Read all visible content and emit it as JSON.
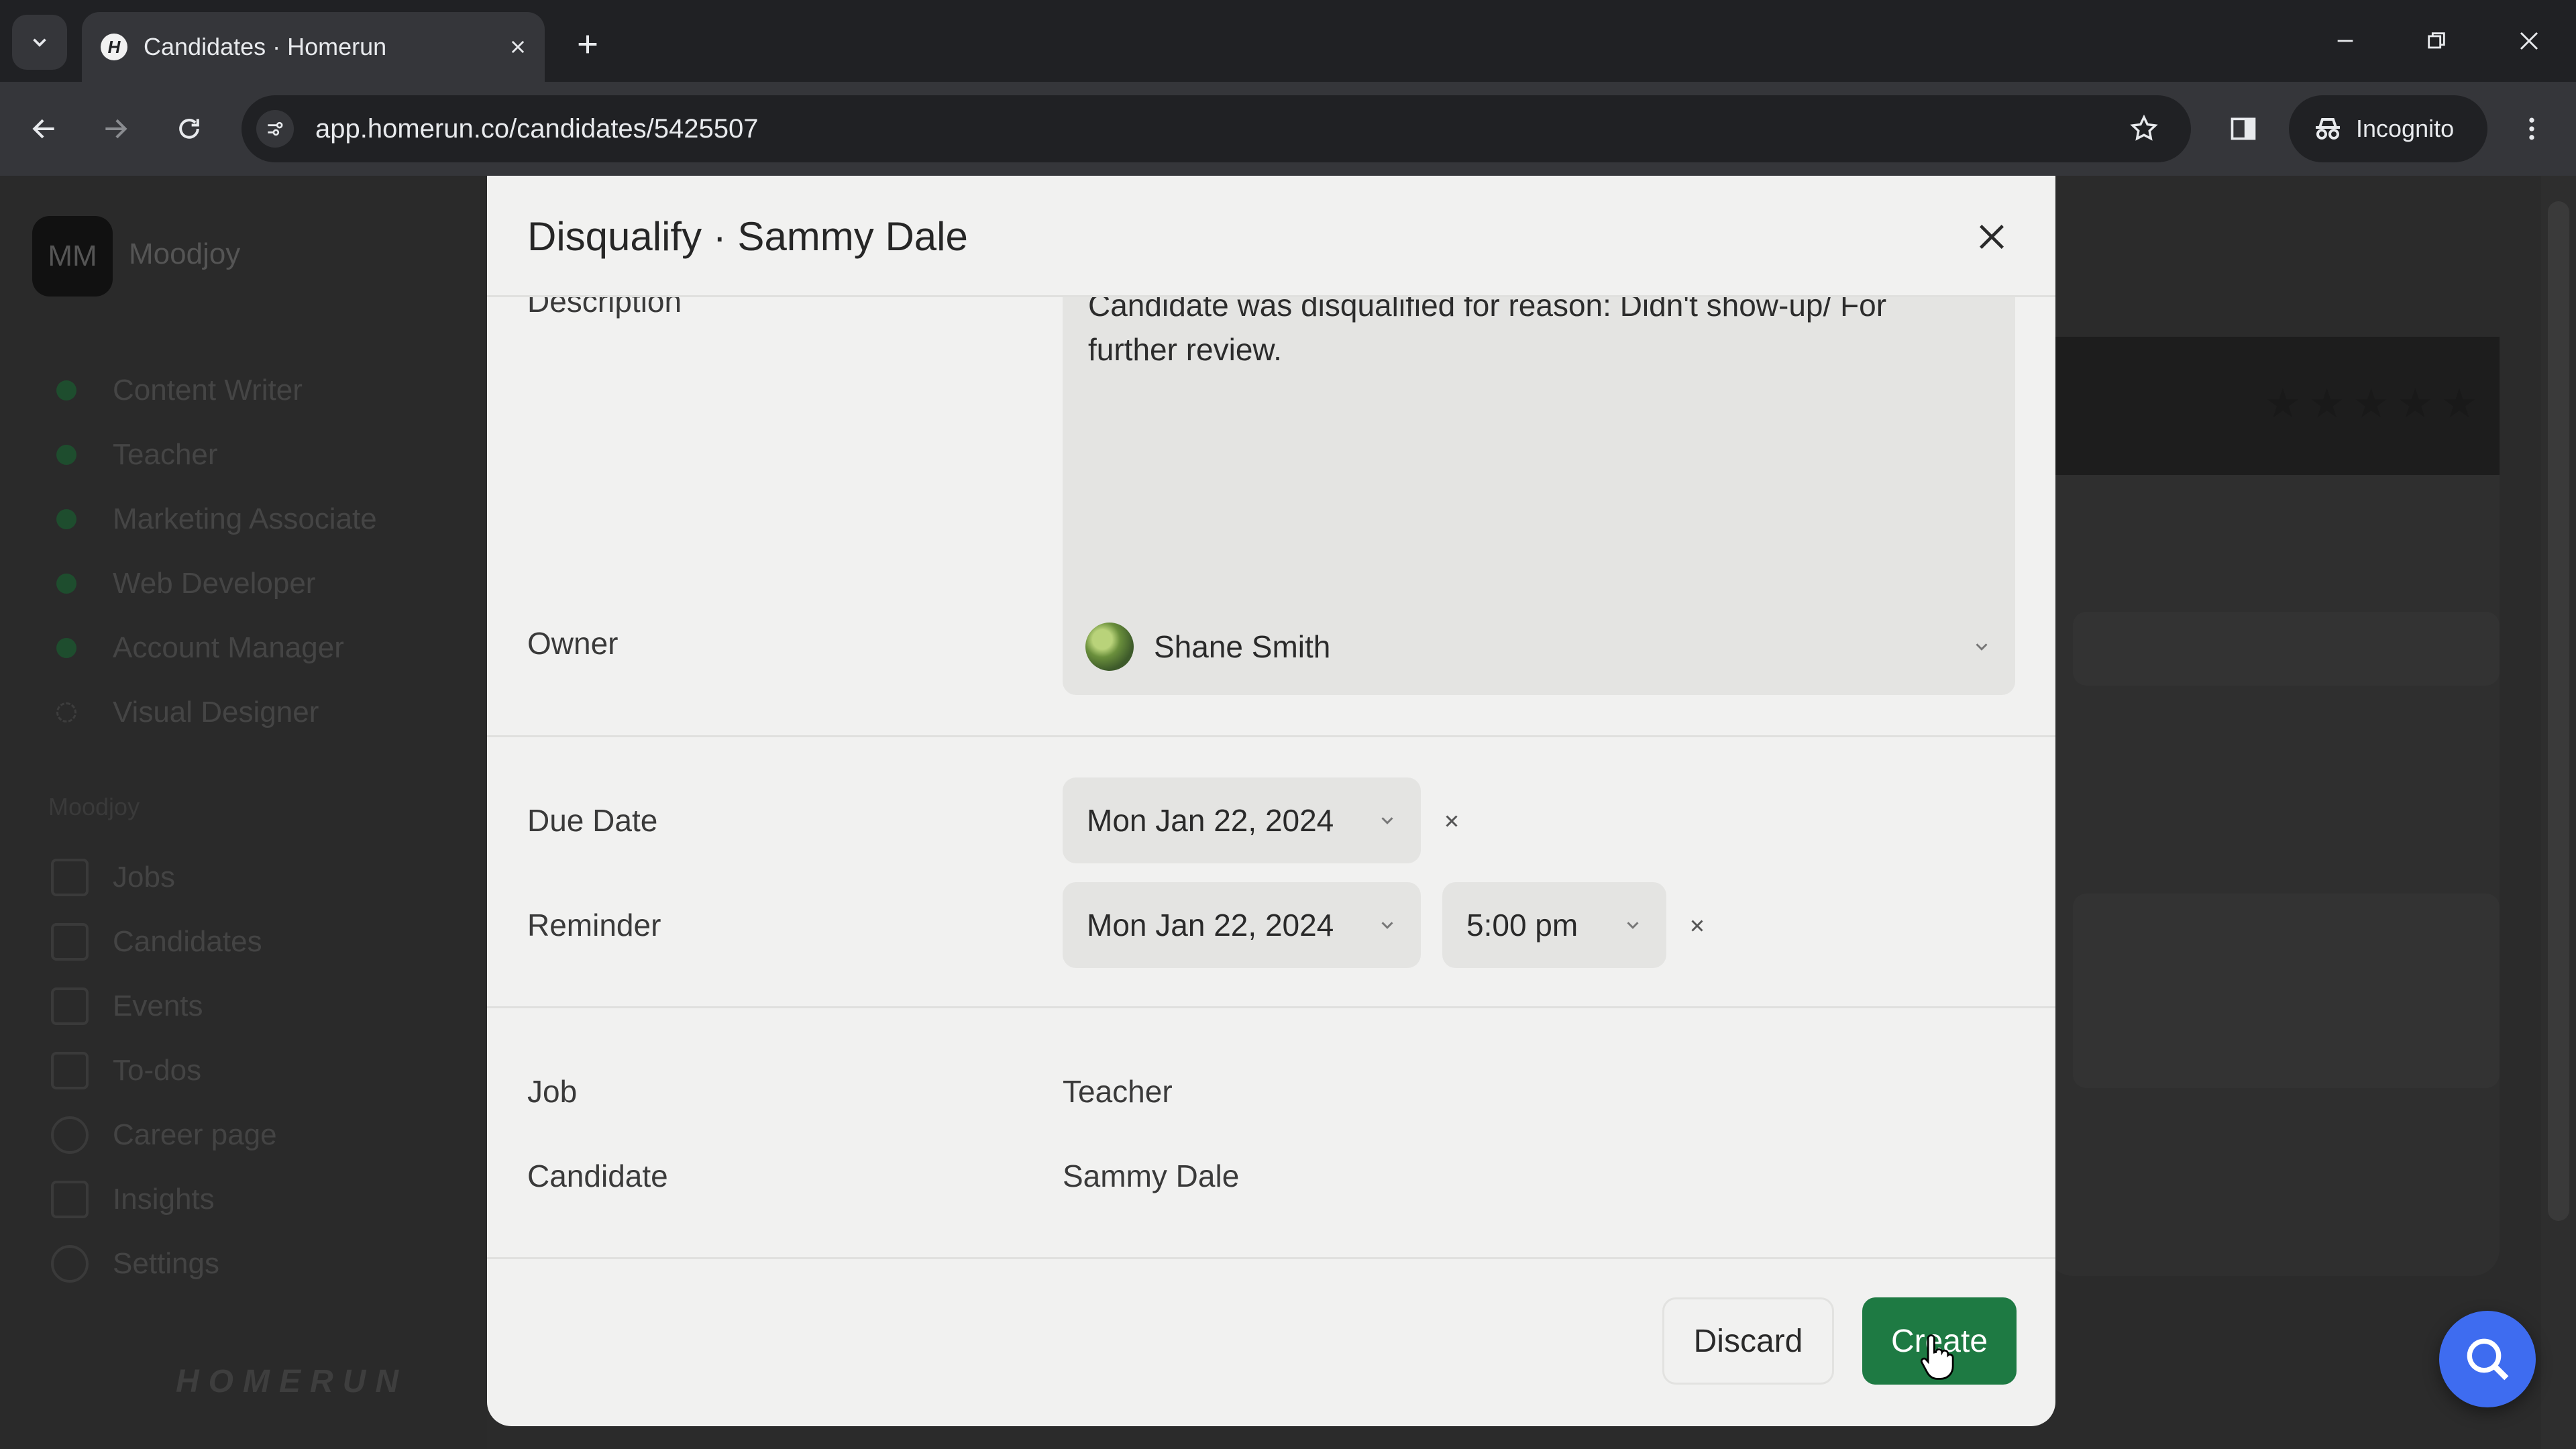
{
  "browser": {
    "tab_title": "Candidates · Homerun",
    "favicon_letter": "H",
    "url": "app.homerun.co/candidates/5425507",
    "incognito_label": "Incognito"
  },
  "background_app": {
    "workspace_initials": "MM",
    "workspace_name": "Moodjoy",
    "jobs": [
      "Content Writer",
      "Teacher",
      "Marketing Associate",
      "Web Developer",
      "Account Manager",
      "Visual Designer"
    ],
    "section_label": "Moodjoy",
    "nav": [
      "Jobs",
      "Candidates",
      "Events",
      "To-dos",
      "Career page",
      "Insights",
      "Settings"
    ],
    "brand": "HOMERUN"
  },
  "modal": {
    "title": "Disqualify · Sammy Dale",
    "description_label": "Description",
    "description_value": "Candidate was disqualified for reason: Didn't show-up/ For further review.",
    "owner_label": "Owner",
    "owner_value": "Shane Smith",
    "due_date_label": "Due Date",
    "due_date_value": "Mon Jan 22, 2024",
    "reminder_label": "Reminder",
    "reminder_date_value": "Mon Jan 22, 2024",
    "reminder_time_value": "5:00 pm",
    "job_label": "Job",
    "job_value": "Teacher",
    "candidate_label": "Candidate",
    "candidate_value": "Sammy Dale",
    "discard_label": "Discard",
    "create_label": "Create"
  },
  "colors": {
    "create_button": "#1e7a43",
    "help_button": "#3e6cf0",
    "modal_background": "#f1f1f0"
  }
}
